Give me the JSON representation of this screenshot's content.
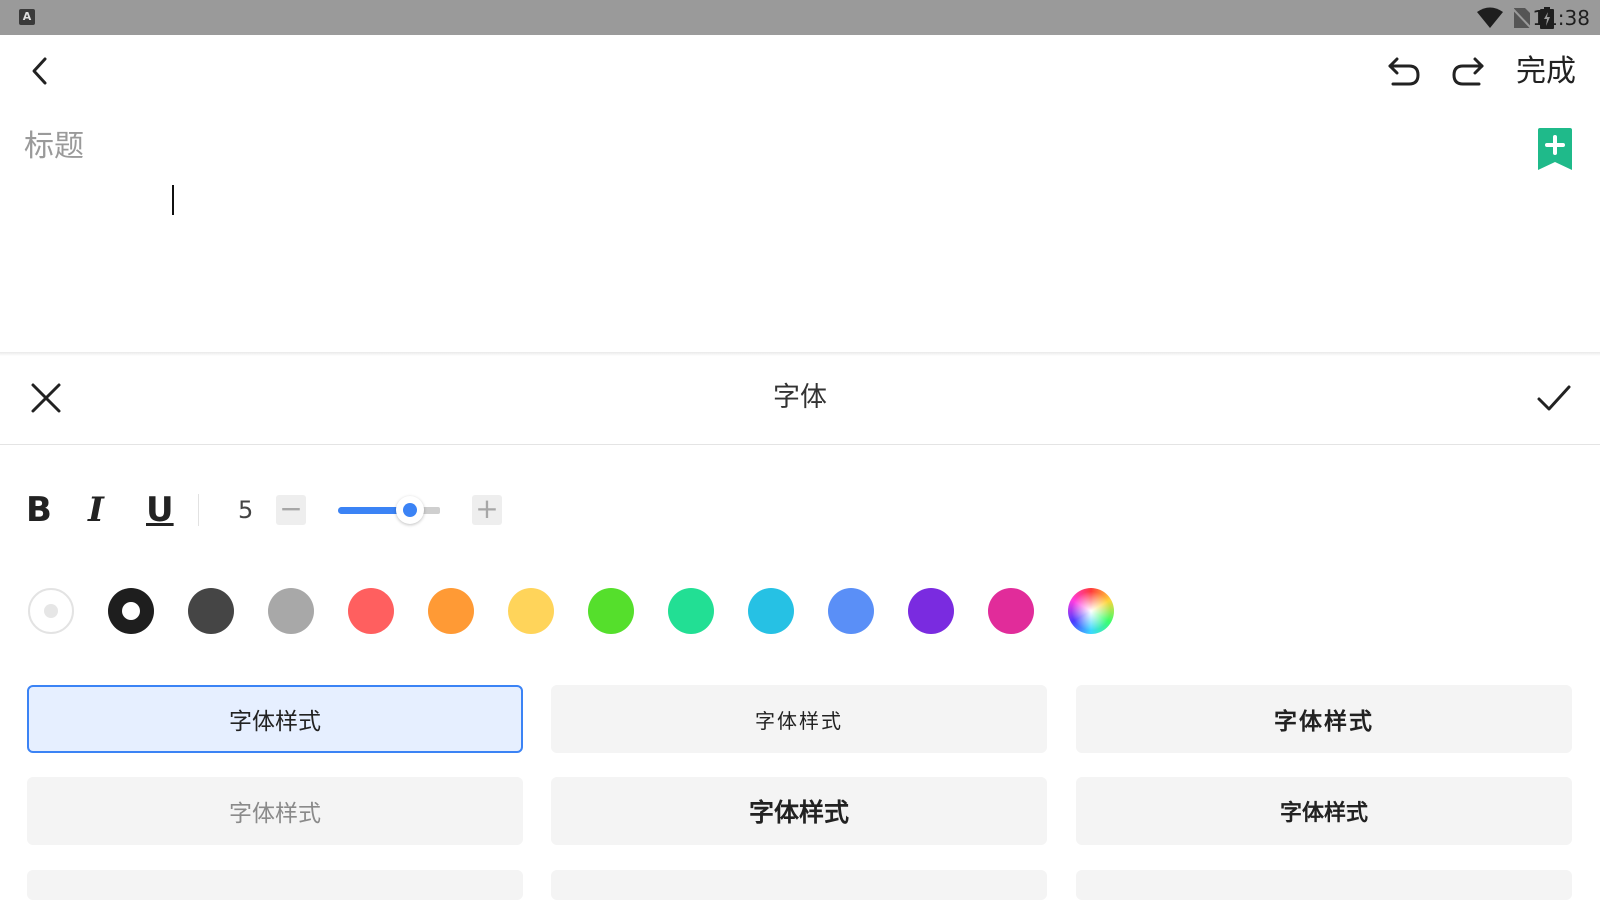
{
  "status_bar": {
    "app_icon_label": "A",
    "time": "11:38",
    "icons": [
      "wifi-icon",
      "no-sim-icon",
      "battery-charging-icon"
    ]
  },
  "toolbar": {
    "back_icon": "back-arrow-icon",
    "undo_icon": "undo-icon",
    "redo_icon": "redo-icon",
    "done_label": "完成"
  },
  "editor": {
    "title_placeholder": "标题",
    "title_value": "",
    "bookmark_icon": "bookmark-add-icon",
    "accent_color": "#1fba8a"
  },
  "font_panel": {
    "title": "字体",
    "close_icon": "close-icon",
    "confirm_icon": "check-icon",
    "format_buttons": [
      {
        "name": "bold",
        "label": "B"
      },
      {
        "name": "italic",
        "label": "I"
      },
      {
        "name": "underline",
        "label": "U"
      }
    ],
    "font_size": {
      "value": "5",
      "minus_label": "−",
      "plus_label": "+",
      "slider_fraction": 0.72,
      "slider_color": "#3b83f5"
    },
    "colors": [
      {
        "name": "white",
        "hex": "#ffffff"
      },
      {
        "name": "black",
        "hex": "#1e1e1e",
        "selected": true
      },
      {
        "name": "dark-gray",
        "hex": "#454545"
      },
      {
        "name": "gray",
        "hex": "#a8a8a8"
      },
      {
        "name": "red",
        "hex": "#ff5f5f"
      },
      {
        "name": "orange",
        "hex": "#ff9a35"
      },
      {
        "name": "yellow",
        "hex": "#ffd45a"
      },
      {
        "name": "green",
        "hex": "#55df2c"
      },
      {
        "name": "teal",
        "hex": "#22df94"
      },
      {
        "name": "cyan",
        "hex": "#26c1e4"
      },
      {
        "name": "blue",
        "hex": "#5a8ff7"
      },
      {
        "name": "purple",
        "hex": "#7a2be0"
      },
      {
        "name": "pink",
        "hex": "#e12c9a"
      },
      {
        "name": "custom",
        "hex": "rainbow"
      }
    ],
    "font_styles": [
      {
        "label": "字体样式",
        "selected": true
      },
      {
        "label": "字体样式"
      },
      {
        "label": "字体样式"
      },
      {
        "label": "字体样式"
      },
      {
        "label": "字体样式"
      },
      {
        "label": "字体样式"
      }
    ]
  }
}
